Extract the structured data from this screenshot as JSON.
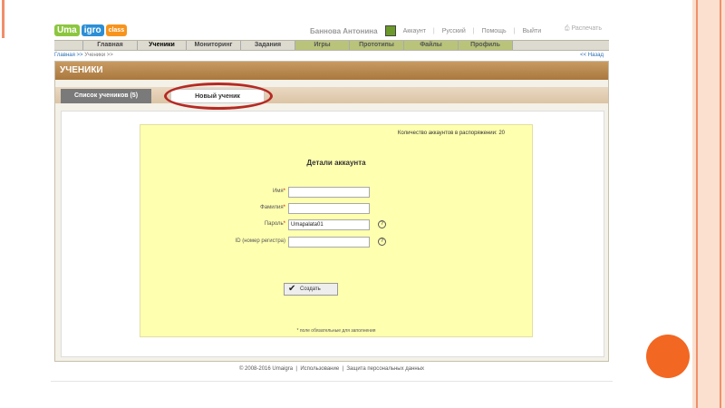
{
  "header": {
    "logo": [
      "Uma",
      "igro",
      "class"
    ],
    "user_name": "Баннова Антонина",
    "links": [
      "Аккаунт",
      "Русский",
      "Помощь",
      "Выйти"
    ],
    "print": "Распечать"
  },
  "menu": [
    {
      "label": "Главная",
      "style": "plain"
    },
    {
      "label": "Ученики",
      "style": "active"
    },
    {
      "label": "Мониторинг",
      "style": "plain"
    },
    {
      "label": "Задания",
      "style": "plain"
    },
    {
      "label": "Игры",
      "style": "green"
    },
    {
      "label": "Прототипы",
      "style": "green"
    },
    {
      "label": "Файлы",
      "style": "green"
    },
    {
      "label": "Профиль",
      "style": "green"
    }
  ],
  "breadcrumb": {
    "home": "Главная >>",
    "current": "Ученики >>",
    "back": "<< Назад"
  },
  "page_title": "УЧЕНИКИ",
  "tabs": {
    "list": "Список учеников (5)",
    "new": "Новый ученик"
  },
  "form": {
    "quota": "Количество аккаунтов в распоряжении: 20",
    "title": "Детали аккаунта",
    "fields": [
      {
        "label": "Имя",
        "required": "*",
        "value": "",
        "help": ""
      },
      {
        "label": "Фамилия",
        "required": "*",
        "value": "",
        "help": ""
      },
      {
        "label": "Пароль",
        "required": "*",
        "value": "Umapalata01",
        "help": "?"
      },
      {
        "label": "ID (номер регистра)",
        "required": "",
        "value": "",
        "help": "?"
      }
    ],
    "submit": "Создать",
    "note": "* поле обязательные для заполнения"
  },
  "footer": {
    "copyright": "© 2008-2016 Umaigra",
    "links": [
      "Использование",
      "Защита персональных данных"
    ]
  },
  "colors": {
    "accent": "#f26722",
    "title_bar": "#b8864a",
    "form_bg": "#ffffb0",
    "highlight": "#b52a24"
  }
}
